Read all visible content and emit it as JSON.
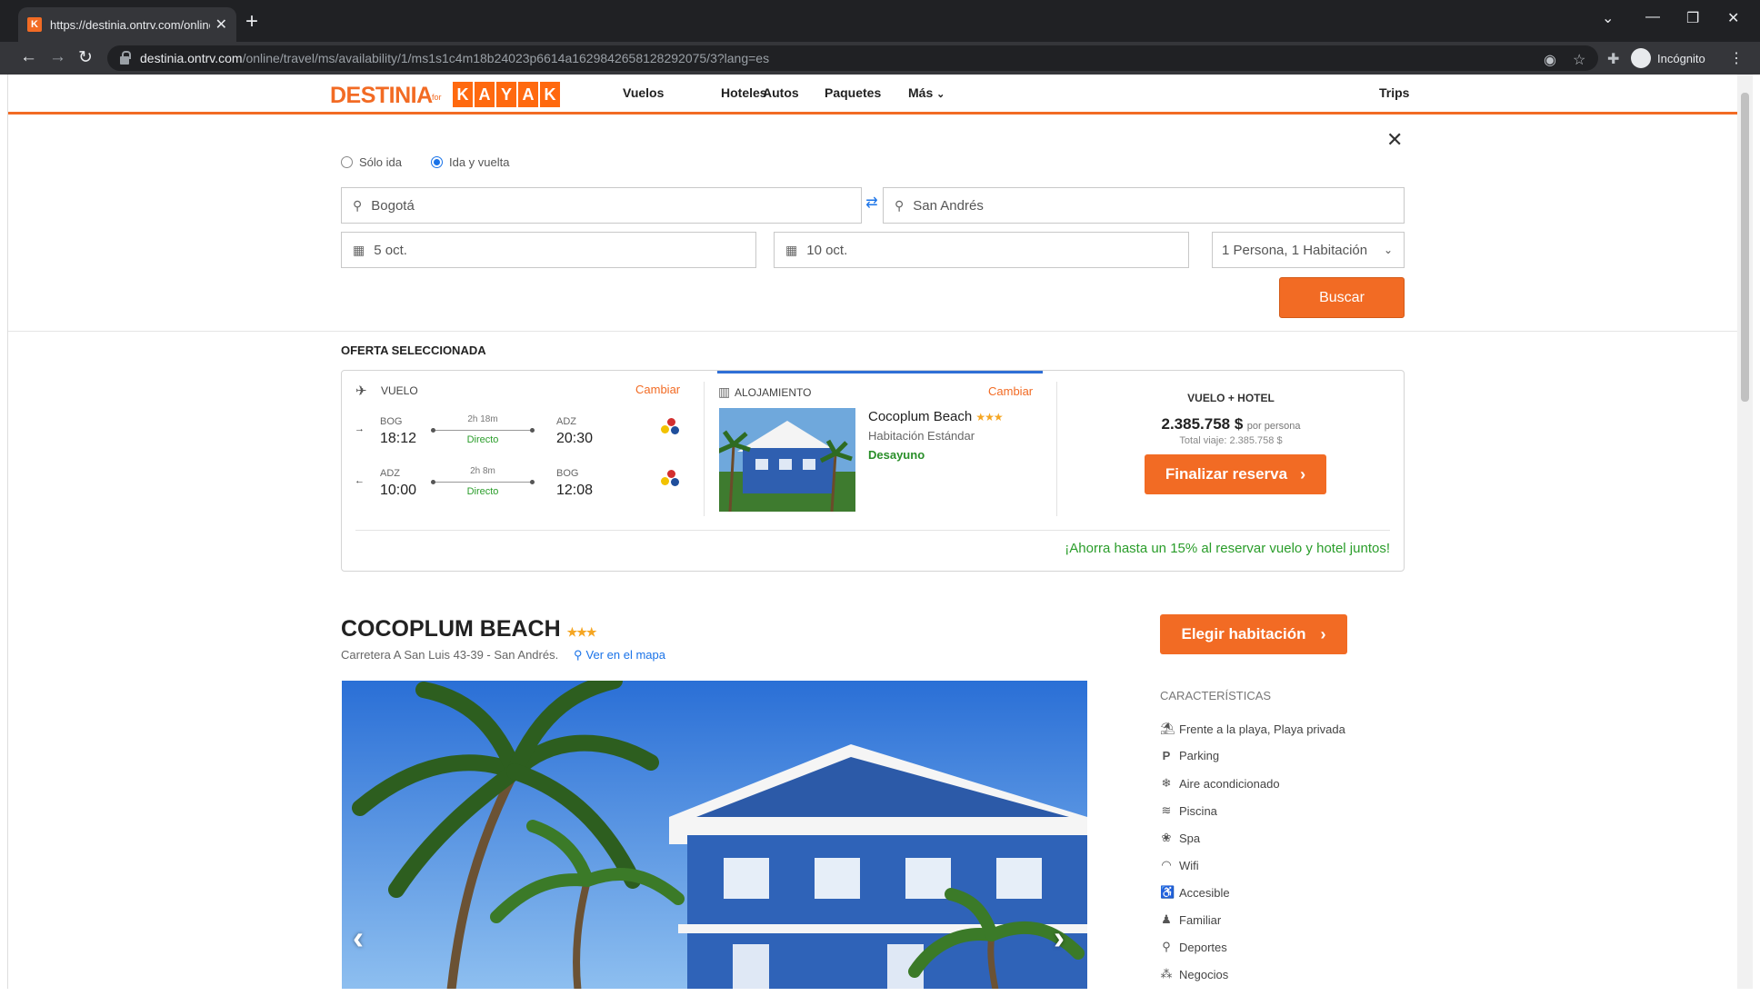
{
  "browser": {
    "tab_title": "https://destinia.ontrv.com/online",
    "url_host": "destinia.ontrv.com",
    "url_path": "/online/travel/ms/availability/1/ms1s1c4m18b24023p6614a1629842658128292075/3?lang=es",
    "incognito_label": "Incógnito"
  },
  "header": {
    "logo_destinia": "DESTINIA",
    "logo_for": "for",
    "logo_kayak": [
      "K",
      "A",
      "Y",
      "A",
      "K"
    ],
    "nav": [
      "Vuelos",
      "Hoteles",
      "Autos",
      "Paquetes",
      "Más"
    ],
    "trips": "Trips"
  },
  "search": {
    "one_way": "Sólo ida",
    "round_trip": "Ida y vuelta",
    "origin": "Bogotá",
    "destination": "San Andrés",
    "date_from": "5 oct.",
    "date_to": "10 oct.",
    "guests": "1 Persona, 1 Habitación",
    "button": "Buscar"
  },
  "offer": {
    "section_title": "OFERTA SELECCIONADA",
    "flight_label": "VUELO",
    "change": "Cambiar",
    "outbound": {
      "from": "BOG",
      "dep": "18:12",
      "duration": "2h 18m",
      "type": "Directo",
      "to": "ADZ",
      "arr": "20:30"
    },
    "return": {
      "from": "ADZ",
      "dep": "10:00",
      "duration": "2h 8m",
      "type": "Directo",
      "to": "BOG",
      "arr": "12:08"
    },
    "lodging_label": "ALOJAMIENTO",
    "hotel_name": "Cocoplum Beach",
    "hotel_stars": "★★★",
    "room": "Habitación Estándar",
    "board": "Desayuno",
    "package_label": "VUELO + HOTEL",
    "price": "2.385.758 $",
    "per_person": "por persona",
    "total": "Total viaje: 2.385.758 $",
    "finish_button": "Finalizar reserva",
    "savings": "¡Ahorra hasta un 15% al reservar vuelo y hotel juntos!"
  },
  "hotel": {
    "name": "COCOPLUM BEACH",
    "stars": "★★★",
    "address": "Carretera A San Luis 43-39 - San Andrés.",
    "map_link": "Ver en el mapa",
    "choose_room": "Elegir habitación",
    "features_title": "CARACTERÍSTICAS",
    "features": [
      {
        "label": "Frente a la playa, Playa privada",
        "icon": "beach-icon"
      },
      {
        "label": "Parking",
        "icon": "parking-icon"
      },
      {
        "label": "Aire acondicionado",
        "icon": "snowflake-icon"
      },
      {
        "label": "Piscina",
        "icon": "pool-icon"
      },
      {
        "label": "Spa",
        "icon": "spa-icon"
      },
      {
        "label": "Wifi",
        "icon": "wifi-icon"
      },
      {
        "label": "Accesible",
        "icon": "wheelchair-icon"
      },
      {
        "label": "Familiar",
        "icon": "family-icon"
      },
      {
        "label": "Deportes",
        "icon": "sports-icon"
      },
      {
        "label": "Negocios",
        "icon": "business-icon"
      }
    ]
  },
  "colors": {
    "accent": "#f26b24",
    "link": "#1a73e8",
    "green": "#2a9d2a"
  }
}
